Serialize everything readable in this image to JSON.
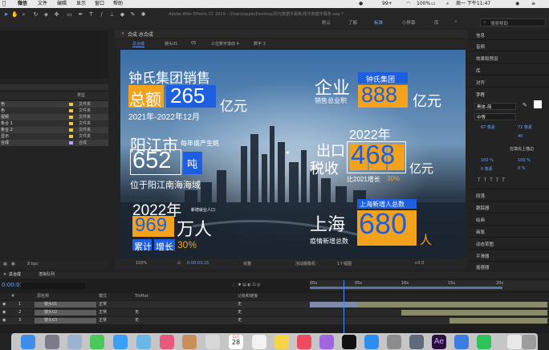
{
  "menubar": {
    "app": "微信",
    "items": [
      "文件",
      "编辑",
      "显示",
      "窗口",
      "帮助"
    ],
    "battery": "99+",
    "battery_pct": "100%",
    "clock": "周一 下午11:47"
  },
  "toolbar": {
    "window_title": "Adobe After Effects CC 2019 - /Users/apple/Desktop/阳光数据字幕条/阳光数据字幕条.aep *",
    "workspaces": [
      "默认",
      "了解",
      "标准",
      "小屏幕",
      "库"
    ],
    "search_label": "搜索帮助"
  },
  "left_panel": {
    "rows": [
      {
        "name": "色",
        "type": "文件夹"
      },
      {
        "name": "色",
        "type": "文件夹"
      },
      {
        "name": "视频",
        "type": "文件夹"
      },
      {
        "name": "条合 1",
        "type": "文件夹"
      },
      {
        "name": "条合 2",
        "type": "文件夹"
      },
      {
        "name": "显示",
        "type": "文件夹"
      },
      {
        "name": "合成",
        "type": "合成"
      }
    ],
    "header_type": "类型",
    "bpc": "8 bpc"
  },
  "composition": {
    "tab": "合成 总合成",
    "nav": [
      "总合成",
      "镜头01",
      "05",
      "三位数字滚动 4",
      "数字 3"
    ],
    "zoom": "100%",
    "timecode": "0:00:03:15",
    "quality": "完整",
    "camera": "活动摄像机",
    "views": "1个视图",
    "offset": "+0.0"
  },
  "overlay": {
    "b1_title": "钟氏集团销售",
    "b1_label": "总额",
    "b1_value": "265",
    "b1_unit": "亿元",
    "b1_period": "2021年-2022年12月",
    "b2_tag": "钟氏集团",
    "b2_title": "企业",
    "b2_sub": "销售总业积",
    "b2_value": "888",
    "b2_unit": "亿元",
    "b3_city": "阳江市",
    "b3_sub": "每年盛产生蚝",
    "b3_value": "652",
    "b3_unit": "吨",
    "b3_loc": "位于阳江南海海域",
    "b4_year": "2022年",
    "b4_title": "出口",
    "b4_title2": "税收",
    "b4_value": "468",
    "b4_unit": "亿元",
    "b4_growth": "比2021增长",
    "b4_pct": "30%",
    "b5_year": "2022年",
    "b5_sub": "新增就业人口",
    "b5_value": "969",
    "b5_unit": "万人",
    "b5_growth1": "累计",
    "b5_growth2": "增长",
    "b5_pct": "30%",
    "b6_tag": "上海新增人总数",
    "b6_city": "上海",
    "b6_sub": "疫情新增总数",
    "b6_value": "680",
    "b6_unit": "人"
  },
  "right_panel": {
    "items": [
      "信息",
      "音频",
      "效果和预设",
      "库",
      "对齐",
      "字符"
    ],
    "font": "黑体-简",
    "weight": "中等",
    "size": "67 像素",
    "leading": "72 像素",
    "tracking": "40",
    "stroke": "在填充上描边",
    "scale_v": "100 %",
    "scale_h": "100 %",
    "baseline": "0 像素",
    "tsume": "0 %",
    "lower_items": [
      "段落",
      "跟踪器",
      "绘画",
      "画笔",
      "动态草图",
      "平滑器",
      "摇摆器"
    ]
  },
  "timeline": {
    "tab": "总合成",
    "render_tab": "渲染队列",
    "timecode": "0:00:03:15",
    "col_source": "源名称",
    "col_mode": "模式",
    "col_trkmat": "TrkMat",
    "col_parent": "父级和链接",
    "layers": [
      {
        "num": "1",
        "name": "镜头01",
        "mode": "正常",
        "trk": "",
        "parent": "无"
      },
      {
        "num": "2",
        "name": "镜头02",
        "mode": "正常",
        "trk": "无",
        "parent": "无"
      },
      {
        "num": "3",
        "name": "镜头03",
        "mode": "正常",
        "trk": "无",
        "parent": "无"
      }
    ],
    "ruler": [
      "00s",
      "05s",
      "10s",
      "15s",
      "20s"
    ],
    "layer_label": "图层"
  },
  "dock": {
    "calendar_month": "12月",
    "calendar_day": "28",
    "ae_label": "Ae"
  }
}
